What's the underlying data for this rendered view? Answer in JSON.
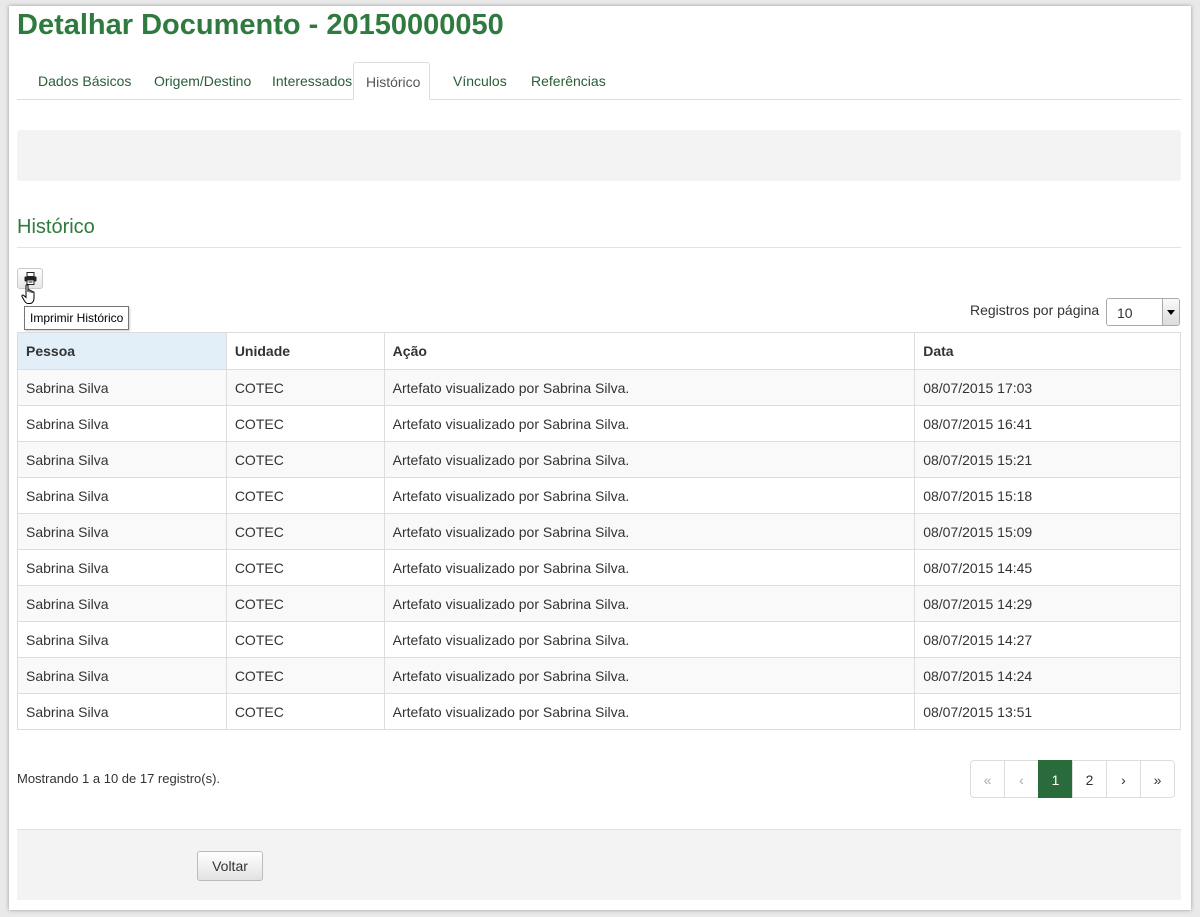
{
  "page": {
    "title": "Detalhar Documento - 20150000050"
  },
  "tabs": [
    {
      "label": "Dados Básicos"
    },
    {
      "label": "Origem/Destino"
    },
    {
      "label": "Interessados"
    },
    {
      "label": "Histórico",
      "active": true
    },
    {
      "label": "Vínculos"
    },
    {
      "label": "Referências"
    }
  ],
  "section": {
    "title": "Histórico"
  },
  "print_button": {
    "icon": "printer-icon",
    "tooltip": "Imprimir Histórico"
  },
  "per_page": {
    "label": "Registros por página",
    "value": "10"
  },
  "table": {
    "headers": [
      "Pessoa",
      "Unidade",
      "Ação",
      "Data"
    ],
    "rows": [
      [
        "Sabrina Silva",
        "COTEC",
        "Artefato visualizado por Sabrina Silva.",
        "08/07/2015 17:03"
      ],
      [
        "Sabrina Silva",
        "COTEC",
        "Artefato visualizado por Sabrina Silva.",
        "08/07/2015 16:41"
      ],
      [
        "Sabrina Silva",
        "COTEC",
        "Artefato visualizado por Sabrina Silva.",
        "08/07/2015 15:21"
      ],
      [
        "Sabrina Silva",
        "COTEC",
        "Artefato visualizado por Sabrina Silva.",
        "08/07/2015 15:18"
      ],
      [
        "Sabrina Silva",
        "COTEC",
        "Artefato visualizado por Sabrina Silva.",
        "08/07/2015 15:09"
      ],
      [
        "Sabrina Silva",
        "COTEC",
        "Artefato visualizado por Sabrina Silva.",
        "08/07/2015 14:45"
      ],
      [
        "Sabrina Silva",
        "COTEC",
        "Artefato visualizado por Sabrina Silva.",
        "08/07/2015 14:29"
      ],
      [
        "Sabrina Silva",
        "COTEC",
        "Artefato visualizado por Sabrina Silva.",
        "08/07/2015 14:27"
      ],
      [
        "Sabrina Silva",
        "COTEC",
        "Artefato visualizado por Sabrina Silva.",
        "08/07/2015 14:24"
      ],
      [
        "Sabrina Silva",
        "COTEC",
        "Artefato visualizado por Sabrina Silva.",
        "08/07/2015 13:51"
      ]
    ]
  },
  "showing": "Mostrando 1 a 10 de 17 registro(s).",
  "pagination": {
    "first": "«",
    "prev": "‹",
    "pages": [
      "1",
      "2"
    ],
    "current": "1",
    "next": "›",
    "last": "»"
  },
  "footer": {
    "back_label": "Voltar"
  },
  "colors": {
    "brand_green": "#2f7a3f",
    "active_page": "#2a6b3c",
    "sorted_header": "#e2eef8"
  }
}
